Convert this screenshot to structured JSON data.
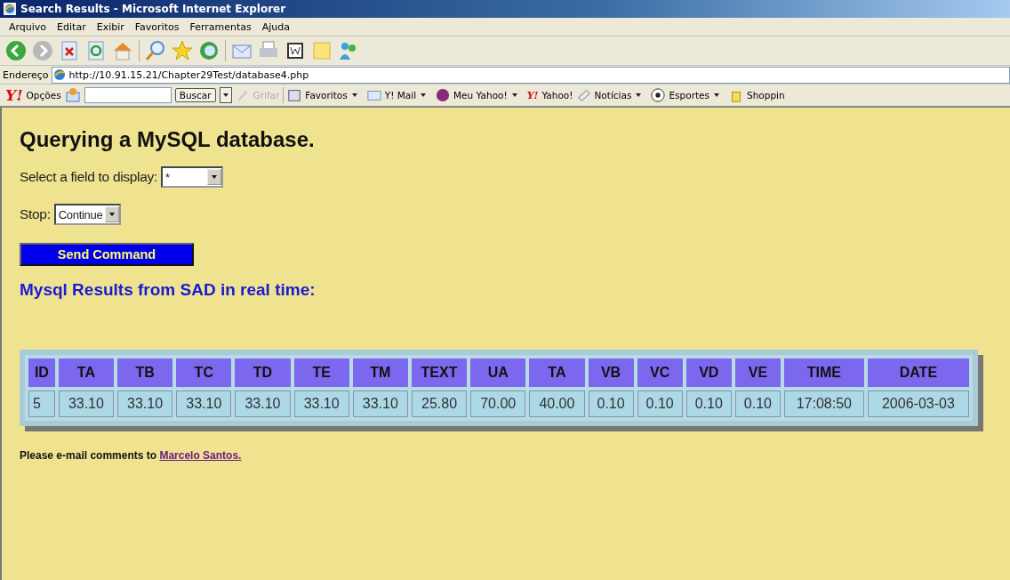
{
  "window": {
    "title": "Search Results - Microsoft Internet Explorer"
  },
  "menu": [
    "Arquivo",
    "Editar",
    "Exibir",
    "Favoritos",
    "Ferramentas",
    "Ajuda"
  ],
  "address": {
    "label": "Endereço",
    "value": "http://10.91.15.21/Chapter29Test/database4.php"
  },
  "yahoo_bar": {
    "logo": "Y!",
    "options": "Opções",
    "search_button": "Buscar",
    "items": [
      {
        "label": "Grifar",
        "disabled": true,
        "caret": false
      },
      {
        "label": "Favoritos",
        "disabled": false,
        "caret": true
      },
      {
        "label": "Y! Mail",
        "disabled": false,
        "caret": true
      },
      {
        "label": "Meu Yahoo!",
        "disabled": false,
        "caret": true
      },
      {
        "label": "Yahoo!",
        "disabled": false,
        "caret": false,
        "logo": "Y!"
      },
      {
        "label": "Notícias",
        "disabled": false,
        "caret": true
      },
      {
        "label": "Esportes",
        "disabled": false,
        "caret": true
      },
      {
        "label": "Shoppin",
        "disabled": false,
        "caret": false
      }
    ]
  },
  "page": {
    "heading": "Querying a MySQL database.",
    "field_select": {
      "label": "Select a field to display:",
      "value": "*"
    },
    "stop_select": {
      "label": "Stop:",
      "value": "Continue"
    },
    "button": "Send Command",
    "results_heading": "Mysql Results from SAD in real time:",
    "table": {
      "columns": [
        "ID",
        "TA",
        "TB",
        "TC",
        "TD",
        "TE",
        "TM",
        "TEXT",
        "UA",
        "TA",
        "VB",
        "VC",
        "VD",
        "VE",
        "TIME",
        "DATE"
      ],
      "rows": [
        [
          "5",
          "33.10",
          "33.10",
          "33.10",
          "33.10",
          "33.10",
          "33.10",
          "25.80",
          "70.00",
          "40.00",
          "0.10",
          "0.10",
          "0.10",
          "0.10",
          "17:08:50",
          "2006-03-03"
        ]
      ]
    },
    "footer": {
      "text": "Please e-mail comments to",
      "link": "Marcelo Santos."
    }
  }
}
